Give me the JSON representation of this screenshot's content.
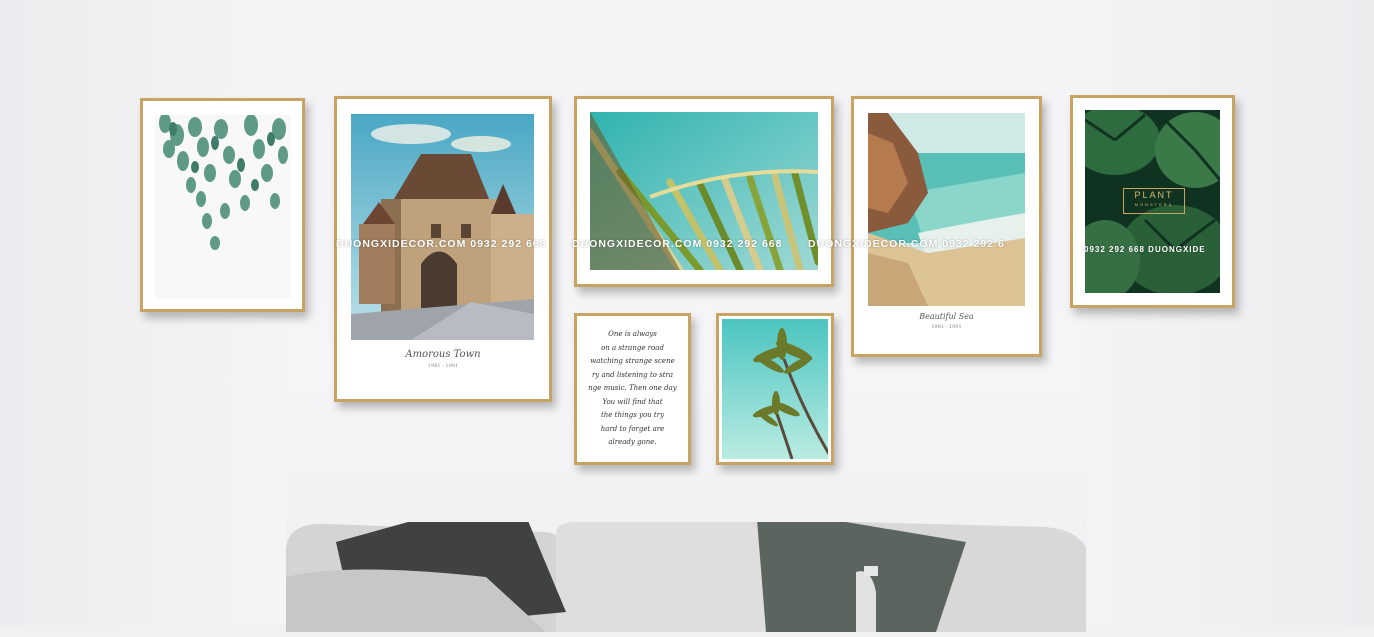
{
  "scene": "Gallery wall of framed prints above a grey sofa",
  "frames": {
    "amorous_town": {
      "title": "Amorous Town",
      "date": "1981 - 1991"
    },
    "beautiful_sea": {
      "title": "Beautiful Sea",
      "date": "1981 - 1991"
    },
    "plant": {
      "title": "PLANT",
      "subtitle": "MONSTERA"
    },
    "quote": {
      "lines": [
        "One is always",
        "on a strange road",
        "watching strange scene",
        "ry and listening to stra",
        "nge music. Then one day",
        "You will find that",
        "the things you try",
        "hard to forget are",
        "already gone."
      ]
    }
  },
  "watermarks": {
    "left": "DUONGXIDECOR.COM  0932 292 668",
    "center": "DUONGXIDECOR.COM  0932 292 668",
    "right": "DUONGXIDECOR.COM  0932 292 6",
    "plant": "0932 292 668  DUONGXIDE"
  },
  "colors": {
    "frame_gold": "#c7a462",
    "wall": "#f3f3f5",
    "sofa": "#d9d9da"
  }
}
